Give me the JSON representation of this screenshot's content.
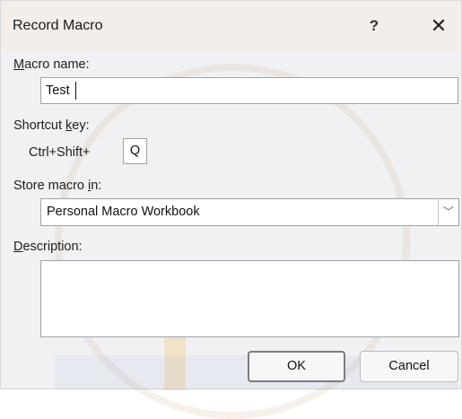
{
  "dialog": {
    "title": "Record Macro",
    "help_label": "?",
    "close_label": "✕"
  },
  "macro_name": {
    "label_underlined": "M",
    "label_rest": "acro name:",
    "value": "Test"
  },
  "shortcut": {
    "label_before": "Shortcut ",
    "label_underlined": "k",
    "label_after": "ey:",
    "prefix": "Ctrl+Shift+",
    "key": "Q"
  },
  "store": {
    "label_before": "Store macro ",
    "label_underlined": "i",
    "label_after": "n:",
    "selected": "Personal Macro Workbook",
    "arrow_icon": "chevron-down"
  },
  "description": {
    "label_underlined": "D",
    "label_rest": "escription:",
    "value": ""
  },
  "buttons": {
    "ok": "OK",
    "cancel": "Cancel"
  }
}
